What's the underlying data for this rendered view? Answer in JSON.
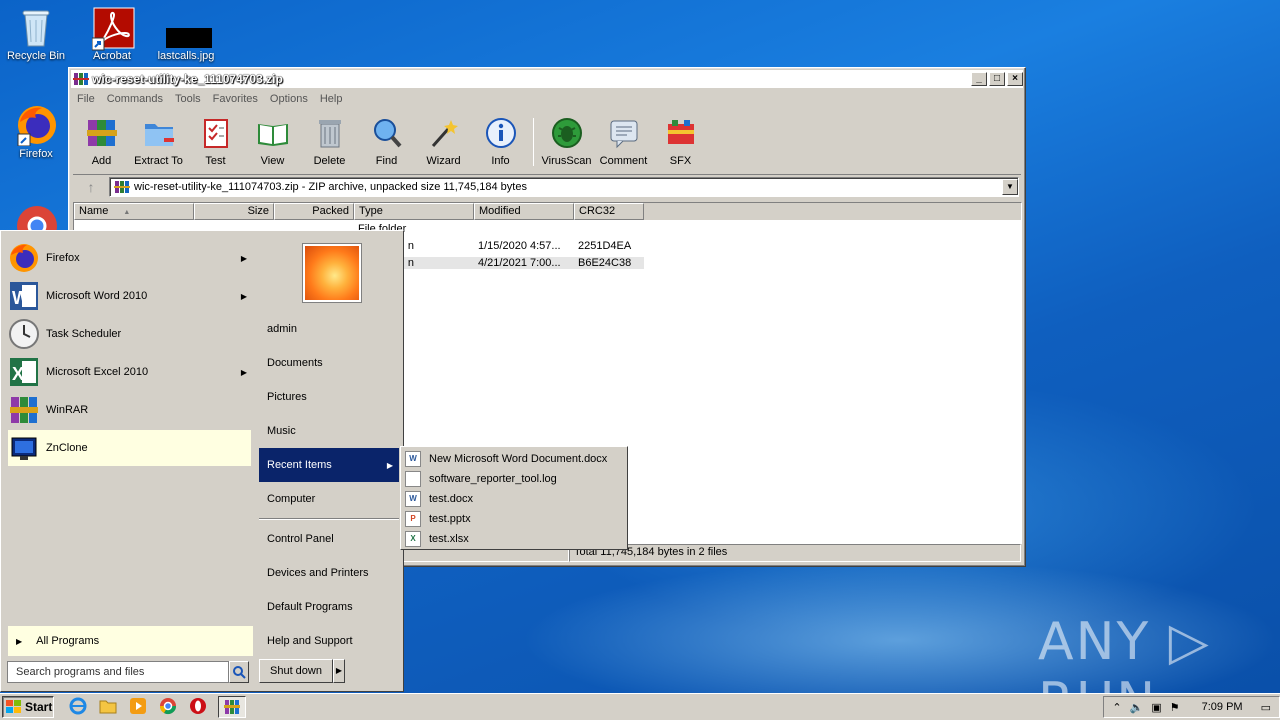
{
  "desktop": {
    "icons": [
      {
        "label": "Recycle Bin",
        "icon": "recycle-bin-icon"
      },
      {
        "label": "Acrobat",
        "icon": "acrobat-icon"
      },
      {
        "label": "lastcalls.jpg",
        "icon": "image-file-icon"
      },
      {
        "label": "Firefox",
        "icon": "firefox-icon"
      }
    ],
    "watermark": "ANY ▷ RUN"
  },
  "winrar": {
    "title": "wic-reset-utility-ke_111074703.zip",
    "menu": [
      "File",
      "Commands",
      "Tools",
      "Favorites",
      "Options",
      "Help"
    ],
    "toolbar": [
      "Add",
      "Extract To",
      "Test",
      "View",
      "Delete",
      "Find",
      "Wizard",
      "Info",
      "VirusScan",
      "Comment",
      "SFX"
    ],
    "address": "wic-reset-utility-ke_111074703.zip - ZIP archive, unpacked size 11,745,184 bytes",
    "columns": [
      "Name",
      "Size",
      "Packed",
      "Type",
      "Modified",
      "CRC32"
    ],
    "rows": [
      {
        "name": "..",
        "size": "",
        "packed": "",
        "type": "File folder",
        "modified": "",
        "crc": ""
      },
      {
        "name": "",
        "size": "",
        "packed": "",
        "type": "n",
        "modified": "1/15/2020 4:57...",
        "crc": "2251D4EA"
      },
      {
        "name": "",
        "size": "",
        "packed": "",
        "type": "n",
        "modified": "4/21/2021 7:00...",
        "crc": "B6E24C38"
      }
    ],
    "status": "Total 11,745,184 bytes in 2 files"
  },
  "startmenu": {
    "programs": [
      {
        "label": "Firefox",
        "has_arrow": true
      },
      {
        "label": "Microsoft Word 2010",
        "has_arrow": true
      },
      {
        "label": "Task Scheduler",
        "has_arrow": false
      },
      {
        "label": "Microsoft Excel 2010",
        "has_arrow": true
      },
      {
        "label": "WinRAR",
        "has_arrow": false
      },
      {
        "label": "ZnClone",
        "has_arrow": false
      }
    ],
    "all_programs": "All Programs",
    "search_placeholder": "Search programs and files",
    "right": [
      "admin",
      "Documents",
      "Pictures",
      "Music",
      "Recent Items",
      "Computer",
      "Control Panel",
      "Devices and Printers",
      "Default Programs",
      "Help and Support"
    ],
    "shutdown": "Shut down",
    "recent_items": [
      {
        "label": "New Microsoft Word Document.docx",
        "kind": "W"
      },
      {
        "label": "software_reporter_tool.log",
        "kind": ""
      },
      {
        "label": "test.docx",
        "kind": "W"
      },
      {
        "label": "test.pptx",
        "kind": "P"
      },
      {
        "label": "test.xlsx",
        "kind": "X"
      }
    ]
  },
  "taskbar": {
    "start": "Start",
    "clock": "7:09 PM"
  },
  "colors": {
    "selection": "#0a246a",
    "highlight": "#ffffe1",
    "desktop": "#1a7fe0"
  }
}
